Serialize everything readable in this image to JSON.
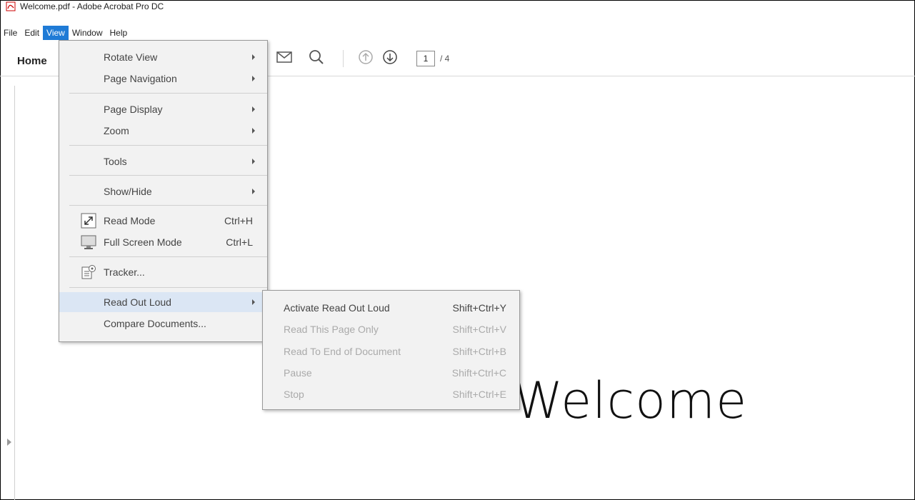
{
  "window": {
    "title": "Welcome.pdf - Adobe Acrobat Pro DC"
  },
  "menubar": {
    "items": [
      "File",
      "Edit",
      "View",
      "Window",
      "Help"
    ]
  },
  "toolbar": {
    "home_label": "Home",
    "page_current": "1",
    "page_total": "/ 4"
  },
  "document": {
    "heading": "Welcome"
  },
  "view_menu": {
    "rotate_view": "Rotate View",
    "page_navigation": "Page Navigation",
    "page_display": "Page Display",
    "zoom": "Zoom",
    "tools": "Tools",
    "show_hide": "Show/Hide",
    "read_mode": "Read Mode",
    "read_mode_shortcut": "Ctrl+H",
    "full_screen_mode": "Full Screen Mode",
    "full_screen_shortcut": "Ctrl+L",
    "tracker": "Tracker...",
    "read_out_loud": "Read Out Loud",
    "compare_documents": "Compare Documents..."
  },
  "read_out_loud_menu": {
    "activate": "Activate Read Out Loud",
    "activate_shortcut": "Shift+Ctrl+Y",
    "this_page": "Read This Page Only",
    "this_page_shortcut": "Shift+Ctrl+V",
    "to_end": "Read To End of Document",
    "to_end_shortcut": "Shift+Ctrl+B",
    "pause": "Pause",
    "pause_shortcut": "Shift+Ctrl+C",
    "stop": "Stop",
    "stop_shortcut": "Shift+Ctrl+E"
  }
}
